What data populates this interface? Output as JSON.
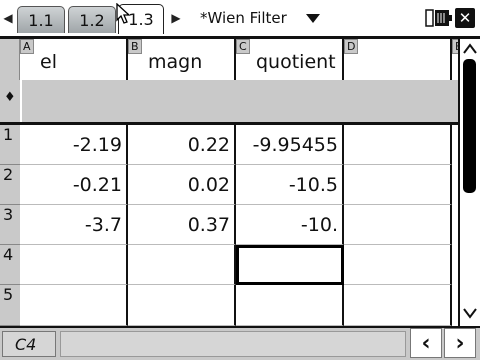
{
  "tabs": [
    {
      "label": "1.1",
      "active": false
    },
    {
      "label": "1.2",
      "active": false
    },
    {
      "label": "1.3",
      "active": true
    }
  ],
  "document": {
    "title": "*Wien Filter"
  },
  "columns": [
    {
      "letter": "A",
      "name": "el"
    },
    {
      "letter": "B",
      "name": "magn"
    },
    {
      "letter": "C",
      "name": "quotient"
    },
    {
      "letter": "D",
      "name": ""
    },
    {
      "letter": "E",
      "name": ""
    }
  ],
  "formula_row_marker": "♦",
  "rows": [
    {
      "num": "1",
      "cells": [
        "-2.19",
        "0.22",
        "-9.95455",
        ""
      ]
    },
    {
      "num": "2",
      "cells": [
        "-0.21",
        "0.02",
        "-10.5",
        ""
      ]
    },
    {
      "num": "3",
      "cells": [
        "-3.7",
        "0.37",
        "-10.",
        ""
      ]
    },
    {
      "num": "4",
      "cells": [
        "",
        "",
        "",
        ""
      ]
    },
    {
      "num": "5",
      "cells": [
        "",
        "",
        "",
        ""
      ]
    }
  ],
  "selected_cell": {
    "row": 4,
    "col": "C"
  },
  "status": {
    "cell_reference": "C4"
  },
  "icons": {
    "tab_left": "triangle-left",
    "tab_right": "triangle-right",
    "doc_menu": "triangle-down",
    "battery": "battery-icon",
    "close": "close-icon",
    "nav_left": "chevron-left",
    "nav_right": "chevron-right"
  }
}
